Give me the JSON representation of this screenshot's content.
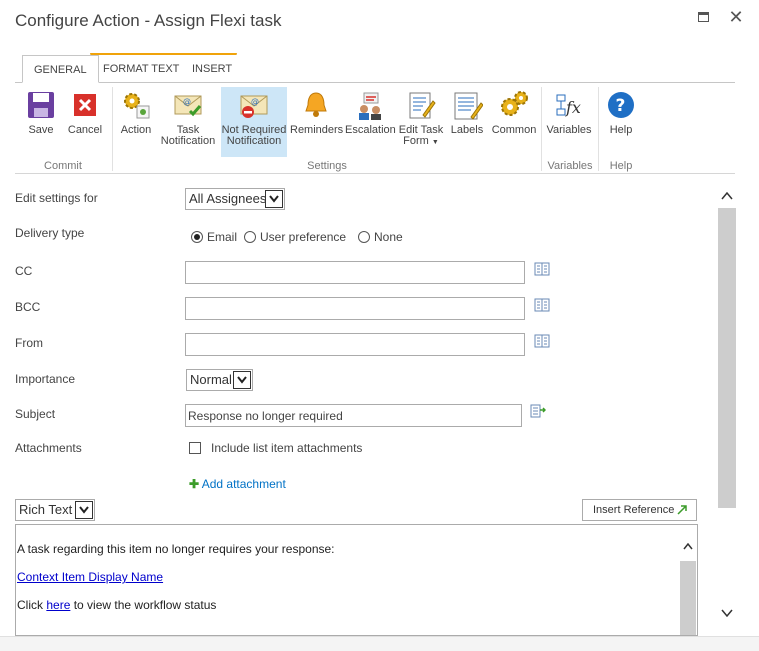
{
  "dialog": {
    "title": "Configure Action - Assign Flexi task"
  },
  "tabs": [
    {
      "label": "GENERAL"
    },
    {
      "label": "FORMAT TEXT"
    },
    {
      "label": "INSERT"
    }
  ],
  "ribbon": {
    "groups": [
      {
        "label": "Commit"
      },
      {
        "label": "Settings"
      },
      {
        "label": "Variables"
      },
      {
        "label": "Help"
      }
    ],
    "buttons": {
      "save": "Save",
      "cancel": "Cancel",
      "action": "Action",
      "task_notification_1": "Task",
      "task_notification_2": "Notification",
      "not_required_1": "Not Required",
      "not_required_2": "Notification",
      "reminders": "Reminders",
      "escalation": "Escalation",
      "edit_task_form_1": "Edit Task",
      "edit_task_form_2": "Form",
      "labels": "Labels",
      "common": "Common",
      "variables": "Variables",
      "help": "Help"
    },
    "selected": "Not Required Notification"
  },
  "form": {
    "edit_settings_for": {
      "label": "Edit settings for",
      "value": "All Assignees"
    },
    "delivery_type": {
      "label": "Delivery type",
      "options": [
        "Email",
        "User preference",
        "None"
      ],
      "selected": "Email"
    },
    "cc": {
      "label": "CC",
      "value": ""
    },
    "bcc": {
      "label": "BCC",
      "value": ""
    },
    "from": {
      "label": "From",
      "value": ""
    },
    "importance": {
      "label": "Importance",
      "value": "Normal"
    },
    "subject": {
      "label": "Subject",
      "value": "Response no longer required"
    },
    "attachments": {
      "label": "Attachments",
      "checkbox_label": "Include list item attachments",
      "checked": false
    },
    "add_attachment": "Add attachment"
  },
  "editor": {
    "format": "Rich Text",
    "insert_reference": "Insert Reference",
    "line1": "A task regarding this item no longer requires your response:",
    "line2_link": "Context Item Display Name",
    "line3_prefix": "Click ",
    "line3_link": "here",
    "line3_suffix": " to view the workflow status"
  },
  "colors": {
    "accent_tab": "#f0a30a",
    "selected_button_bg": "#cde6f7",
    "link": "#0072c6",
    "help_blue": "#1f6fc5"
  }
}
